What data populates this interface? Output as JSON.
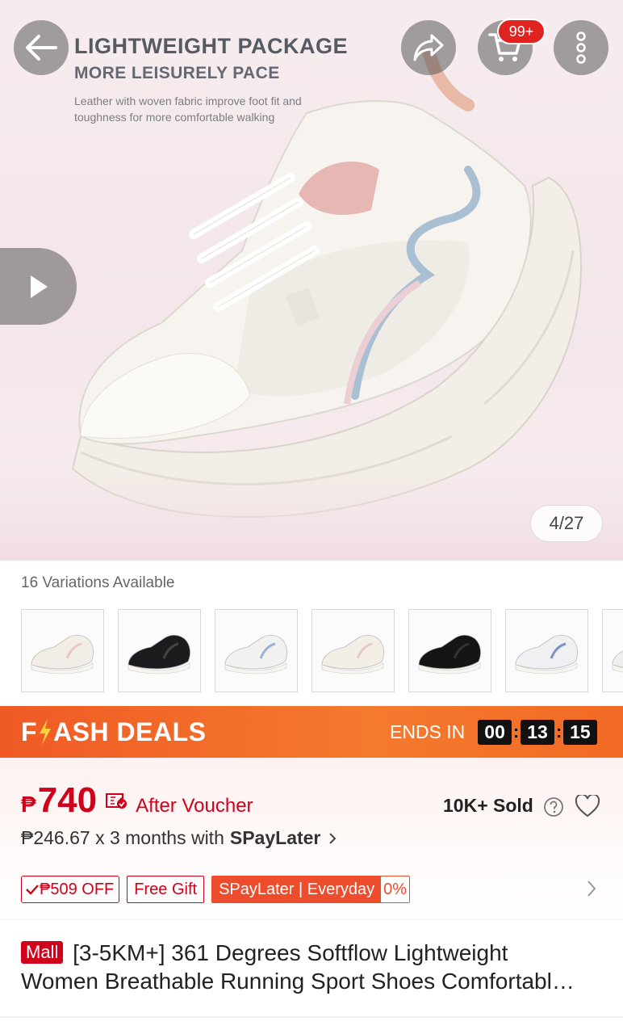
{
  "hero": {
    "title": "LIGHTWEIGHT PACKAGE",
    "subtitle": "MORE LEISURELY PACE",
    "description": "Leather with woven fabric improve foot fit and toughness for more comfortable walking",
    "counter": "4/27",
    "cart_badge": "99+"
  },
  "variations": {
    "label": "16 Variations Available",
    "items": [
      {
        "color": "#f2ede6",
        "accent": "#e8c7c8"
      },
      {
        "color": "#1c1c1e",
        "accent": "#444"
      },
      {
        "color": "#f1f1ef",
        "accent": "#9bb2d6"
      },
      {
        "color": "#f3eee6",
        "accent": "#e6c8c4"
      },
      {
        "color": "#151515",
        "accent": "#333"
      },
      {
        "color": "#eef0f1",
        "accent": "#7e93c8"
      },
      {
        "color": "#efefef",
        "accent": "#ccc"
      }
    ]
  },
  "flash": {
    "title_f": "F",
    "title_rest": "ASH DEALS",
    "ends_in": "ENDS IN",
    "hours": "00",
    "minutes": "13",
    "seconds": "15"
  },
  "price": {
    "currency": "₱",
    "value": "740",
    "after_voucher": "After Voucher",
    "sold": "10K+ Sold",
    "installment_prefix": "₱246.67 x 3 months with",
    "installment_brand": "SPayLater"
  },
  "tags": {
    "off": "₱509 OFF",
    "gift": "Free Gift",
    "spay": "SPayLater | Everyday",
    "spay_rate": "0%"
  },
  "product": {
    "mall_badge": "Mall",
    "title_line1": "[3-5KM+] 361 Degrees Softflow Lightweight",
    "title_line2": "Women Breathable Running Sport Shoes Comfortabl…"
  },
  "colors": {
    "brand_red": "#d0011b",
    "flash_orange": "#f05a25"
  }
}
